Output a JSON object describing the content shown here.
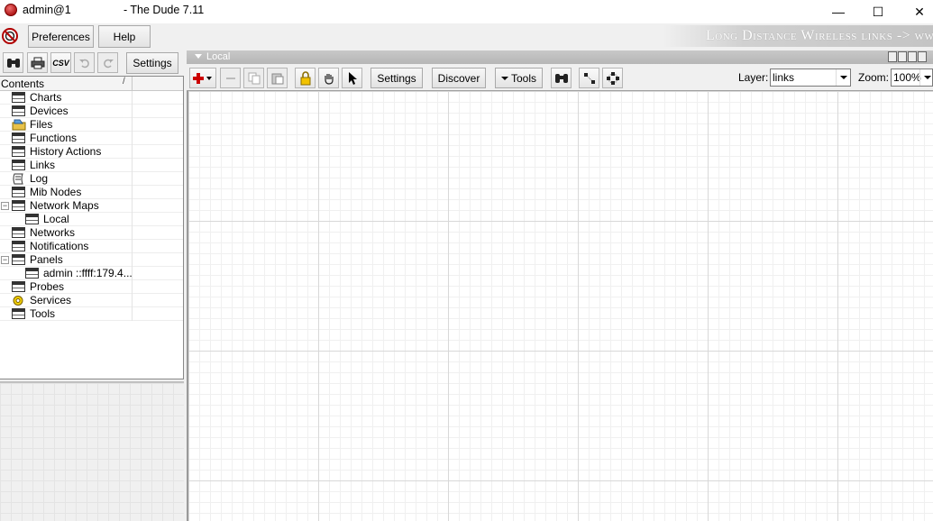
{
  "window": {
    "title_user": "admin@1",
    "title_app": "- The Dude 7.11",
    "minimize": "—",
    "maximize": "☐",
    "close": "✕"
  },
  "toolbar": {
    "preferences": "Preferences",
    "help": "Help",
    "settings": "Settings",
    "csv": "CSV",
    "banner": "Long Distance Wireless links -> www"
  },
  "contents": {
    "header": "Contents",
    "sort_glyph": "/",
    "items": [
      {
        "label": "Charts",
        "icon": "window-icon",
        "indent": 0
      },
      {
        "label": "Devices",
        "icon": "window-icon",
        "indent": 0
      },
      {
        "label": "Files",
        "icon": "files-icon",
        "indent": 0
      },
      {
        "label": "Functions",
        "icon": "window-icon",
        "indent": 0
      },
      {
        "label": "History Actions",
        "icon": "window-icon",
        "indent": 0
      },
      {
        "label": "Links",
        "icon": "window-icon",
        "indent": 0
      },
      {
        "label": "Log",
        "icon": "log-icon",
        "indent": 0
      },
      {
        "label": "Mib Nodes",
        "icon": "window-icon",
        "indent": 0
      },
      {
        "label": "Network Maps",
        "icon": "window-icon",
        "indent": 0,
        "expander": "−"
      },
      {
        "label": "Local",
        "icon": "window-icon",
        "indent": 1
      },
      {
        "label": "Networks",
        "icon": "window-icon",
        "indent": 0
      },
      {
        "label": "Notifications",
        "icon": "window-icon",
        "indent": 0
      },
      {
        "label": "Panels",
        "icon": "window-icon",
        "indent": 0,
        "expander": "−"
      },
      {
        "label": "admin ::ffff:179.4...",
        "icon": "window-icon",
        "indent": 1
      },
      {
        "label": "Probes",
        "icon": "window-icon",
        "indent": 0
      },
      {
        "label": "Services",
        "icon": "services-icon",
        "indent": 0
      },
      {
        "label": "Tools",
        "icon": "window-icon",
        "indent": 0
      }
    ]
  },
  "map": {
    "tab_title": "Local",
    "settings": "Settings",
    "discover": "Discover",
    "tools": "Tools",
    "layer_label": "Layer:",
    "layer_value": "links",
    "zoom_label": "Zoom:",
    "zoom_value": "100%"
  },
  "colors": {
    "accent_red": "#cc0000",
    "banner_text": "#ffffff",
    "grid_major": "#d8d8d8",
    "grid_minor": "#f0f0f0"
  }
}
